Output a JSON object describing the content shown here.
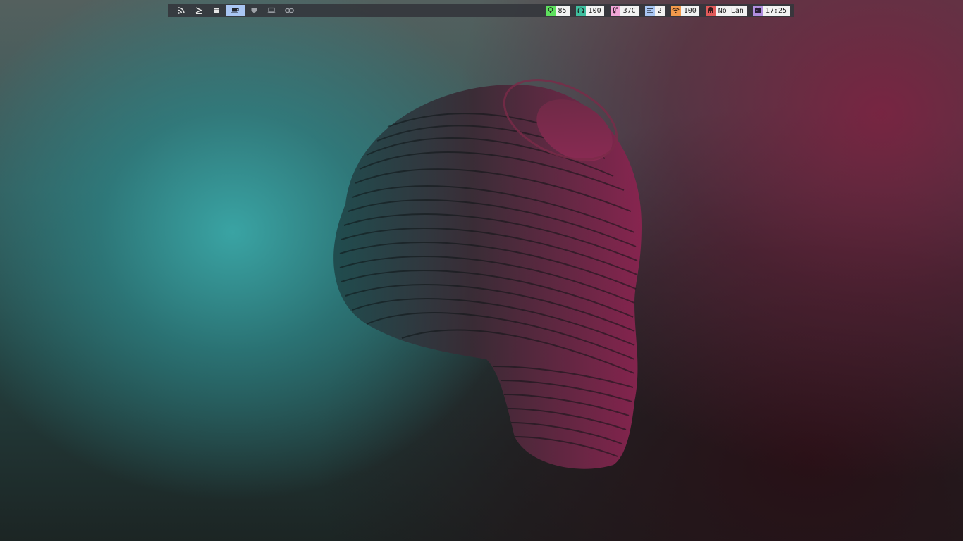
{
  "workspaces": [
    {
      "icon": "rss-icon",
      "active": false
    },
    {
      "icon": "terminal-prompt-icon",
      "active": false
    },
    {
      "icon": "archive-box-icon",
      "active": false
    },
    {
      "icon": "coffee-cup-icon",
      "active": true
    },
    {
      "icon": "shield-icon",
      "active": false
    },
    {
      "icon": "laptop-icon",
      "active": false
    },
    {
      "icon": "link-icon",
      "active": false
    }
  ],
  "modules": {
    "brightness": {
      "icon": "bulb-icon",
      "value": "85",
      "color": "#5ee05e"
    },
    "volume": {
      "icon": "headphones-icon",
      "value": "100",
      "color": "#3fbf9f"
    },
    "temperature": {
      "icon": "thermometer-icon",
      "value": "37C",
      "color": "#f2a6d8"
    },
    "windows": {
      "icon": "lines-icon",
      "value": "2",
      "color": "#a9c6f3"
    },
    "wifi": {
      "icon": "wifi-icon",
      "value": "100",
      "color": "#f39a4c"
    },
    "lan": {
      "icon": "ethernet-icon",
      "value": "No Lan",
      "color": "#e05a5a"
    },
    "clock": {
      "icon": "calendar-icon",
      "value": "17:25",
      "color": "#b18fe0"
    }
  },
  "colors": {
    "bar_bg": "#34363c",
    "active_workspace": "#a9c6f3"
  }
}
